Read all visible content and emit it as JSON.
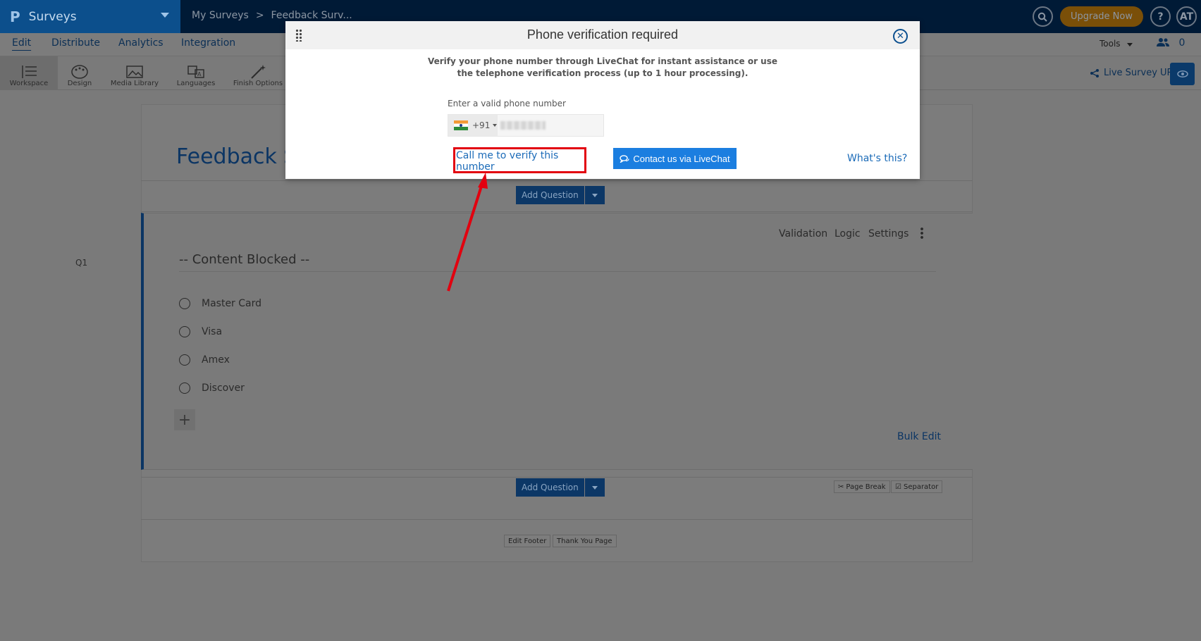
{
  "topbar": {
    "logo": "P",
    "app_name": "Surveys",
    "breadcrumb": [
      "My Surveys",
      "Feedback Surv..."
    ],
    "breadcrumb_sep": ">",
    "upgrade_label": "Upgrade Now",
    "help_label": "?",
    "avatar_initials": "AT"
  },
  "nav": {
    "tabs": [
      "Edit",
      "Distribute",
      "Analytics",
      "Integration"
    ],
    "active_tab": "Edit",
    "tools_label": "Tools",
    "collaborators_count": "0"
  },
  "toolbar": {
    "items": [
      {
        "label": "Workspace",
        "icon": "workspace-icon"
      },
      {
        "label": "Design",
        "icon": "palette-icon"
      },
      {
        "label": "Media Library",
        "icon": "image-icon"
      },
      {
        "label": "Languages",
        "icon": "translate-icon"
      },
      {
        "label": "Finish Options",
        "icon": "magic-wand-icon"
      }
    ],
    "live_url_label": "Live Survey URL"
  },
  "survey": {
    "title": "Feedback S",
    "add_question_label": "Add Question",
    "question": {
      "number": "Q1",
      "text": "-- Content Blocked --",
      "links": [
        "Validation",
        "Logic",
        "Settings"
      ],
      "options": [
        "Master Card",
        "Visa",
        "Amex",
        "Discover"
      ],
      "bulk_edit_label": "Bulk Edit"
    },
    "page_break_label": "Page Break",
    "separator_label": "Separator",
    "edit_footer_label": "Edit Footer",
    "thank_you_label": "Thank You Page"
  },
  "modal": {
    "title": "Phone verification required",
    "description_line1": "Verify your phone number through LiveChat for instant assistance or use",
    "description_line2": "the telephone verification process (up to 1 hour processing).",
    "phone_label": "Enter a valid phone number",
    "country_code": "+91",
    "call_button": "Call me to verify this number",
    "livechat_button": "Contact us via LiveChat",
    "whats_this": "What's this?"
  },
  "colors": {
    "highlight": "#e2000f",
    "primary": "#1b7ee0",
    "link": "#1b6bb8"
  }
}
